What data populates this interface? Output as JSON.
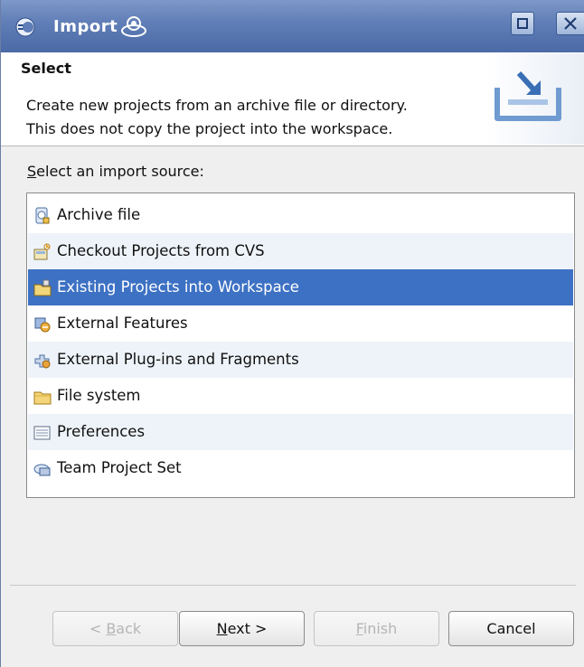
{
  "window": {
    "title": "Import",
    "controls": {
      "maximize": "maximize",
      "close": "close"
    }
  },
  "header": {
    "title": "Select",
    "description_line1": "Create new projects from an archive file or directory.",
    "description_line2": "This does not copy the project into the workspace."
  },
  "main": {
    "source_label_prefix": "",
    "source_label_mnemonic": "S",
    "source_label_rest": "elect an import source:",
    "items": [
      {
        "label": "Archive file",
        "icon": "archive-file-icon"
      },
      {
        "label": "Checkout Projects from CVS",
        "icon": "cvs-checkout-icon"
      },
      {
        "label": "Existing Projects into Workspace",
        "icon": "existing-projects-icon",
        "selected": true
      },
      {
        "label": "External Features",
        "icon": "external-features-icon"
      },
      {
        "label": "External Plug-ins and Fragments",
        "icon": "plugins-fragments-icon"
      },
      {
        "label": "File system",
        "icon": "folder-icon"
      },
      {
        "label": "Preferences",
        "icon": "preferences-icon"
      },
      {
        "label": "Team Project Set",
        "icon": "team-project-set-icon"
      }
    ]
  },
  "buttons": {
    "back": {
      "prefix": "< ",
      "mnemonic": "B",
      "rest": "ack",
      "enabled": false
    },
    "next": {
      "prefix": "",
      "mnemonic": "N",
      "rest": "ext >",
      "enabled": true
    },
    "finish": {
      "prefix": "",
      "mnemonic": "F",
      "rest": "inish",
      "enabled": false
    },
    "cancel": {
      "label": "Cancel",
      "enabled": true
    }
  },
  "colors": {
    "titlebar": "#5f7db6",
    "selection": "#3d71c4",
    "row_alt": "#eef3f9"
  }
}
